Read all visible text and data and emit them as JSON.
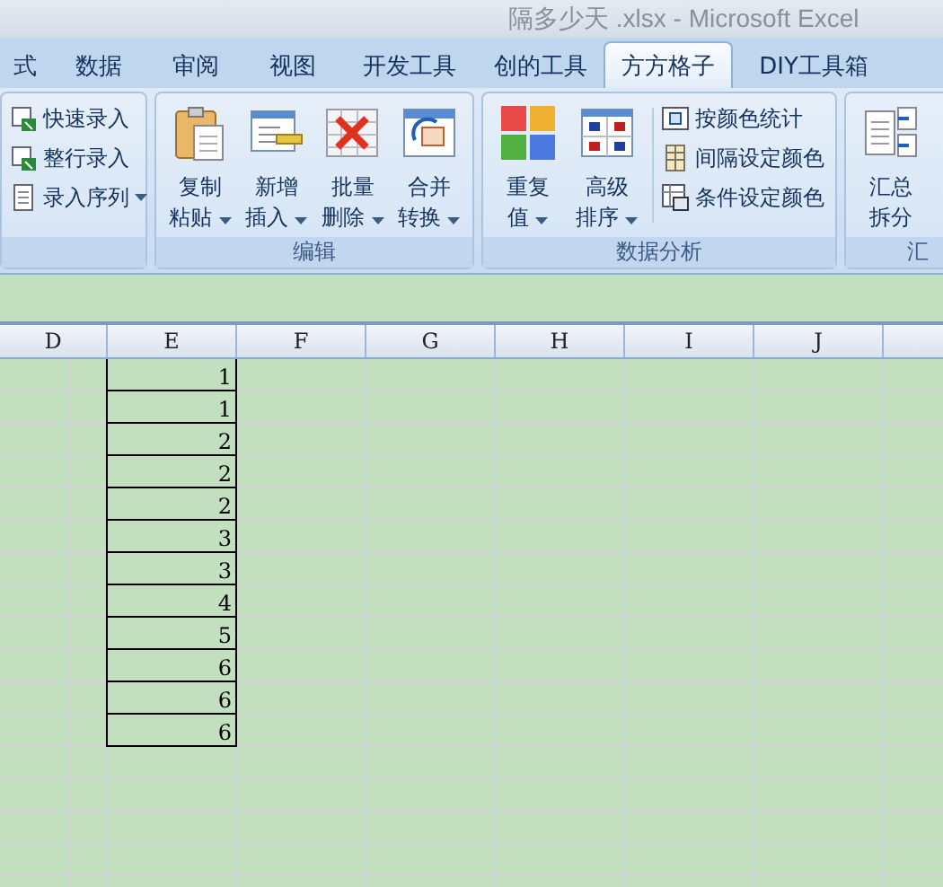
{
  "window": {
    "title": "隔多少天 .xlsx - Microsoft Excel"
  },
  "tabs": [
    {
      "label": "式",
      "selected": false
    },
    {
      "label": "数据",
      "selected": false
    },
    {
      "label": "审阅",
      "selected": false
    },
    {
      "label": "视图",
      "selected": false
    },
    {
      "label": "开发工具",
      "selected": false
    },
    {
      "label": "创的工具",
      "selected": false
    },
    {
      "label": "方方格子",
      "selected": true
    },
    {
      "label": "DIY工具箱",
      "selected": false
    }
  ],
  "ribbon": {
    "groups": [
      {
        "items": [
          {
            "kind": "small",
            "label": "快速录入",
            "dropdown": false
          },
          {
            "kind": "small",
            "label": "整行录入",
            "dropdown": false
          },
          {
            "kind": "small",
            "label": "录入序列",
            "dropdown": true
          }
        ]
      },
      {
        "label": "编辑",
        "items": [
          {
            "kind": "large",
            "lines": [
              "复制",
              "粘贴"
            ],
            "dropdown": true
          },
          {
            "kind": "large",
            "lines": [
              "新增",
              "插入"
            ],
            "dropdown": true
          },
          {
            "kind": "large",
            "lines": [
              "批量",
              "删除"
            ],
            "dropdown": true
          },
          {
            "kind": "large",
            "lines": [
              "合并",
              "转换"
            ],
            "dropdown": true
          }
        ]
      },
      {
        "label": "数据分析",
        "items": [
          {
            "kind": "large",
            "lines": [
              "重复",
              "值"
            ],
            "dropdown": true
          },
          {
            "kind": "large",
            "lines": [
              "高级",
              "排序"
            ],
            "dropdown": true
          },
          {
            "kind": "small",
            "label": "按颜色统计",
            "dropdown": false
          },
          {
            "kind": "small",
            "label": "间隔设定颜色",
            "dropdown": false
          },
          {
            "kind": "small",
            "label": "条件设定颜色",
            "dropdown": false
          }
        ]
      },
      {
        "label": "汇",
        "items": [
          {
            "kind": "large",
            "lines": [
              "汇总",
              "拆分"
            ],
            "dropdown": false
          }
        ]
      }
    ]
  },
  "sheet": {
    "columns": [
      "D",
      "E",
      "F",
      "G",
      "H",
      "I",
      "J"
    ],
    "cells_E": [
      "1",
      "1",
      "2",
      "2",
      "2",
      "3",
      "3",
      "4",
      "5",
      "6",
      "6",
      "6"
    ]
  }
}
